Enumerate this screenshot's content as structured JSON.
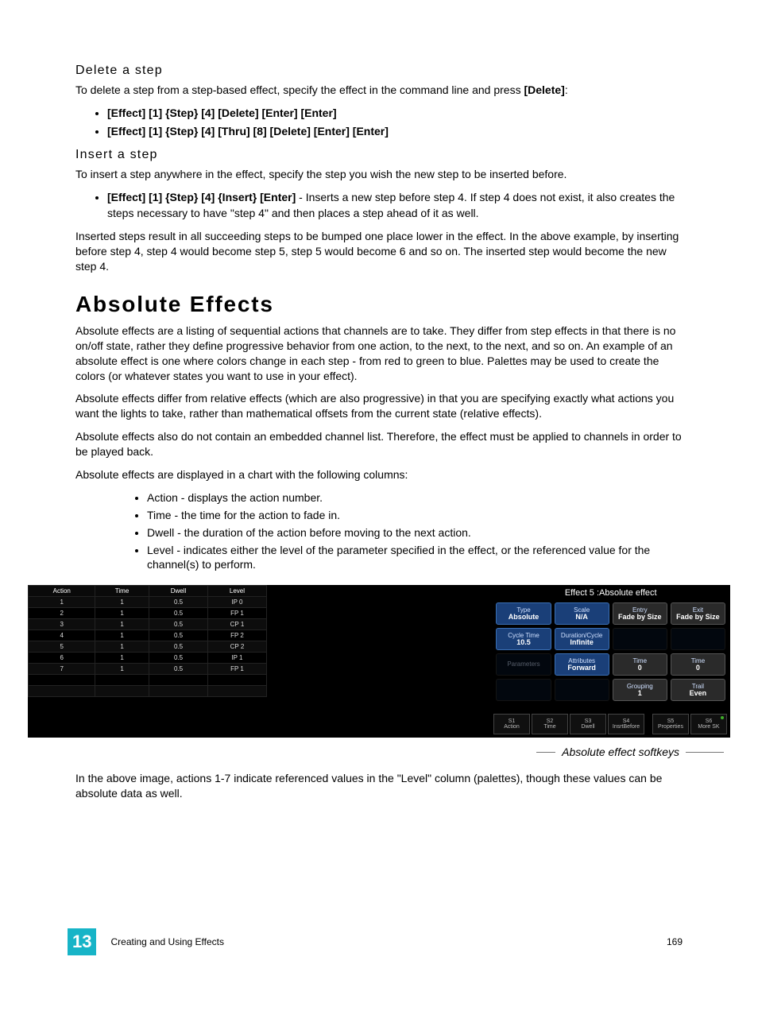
{
  "sections": {
    "delete": {
      "heading": "Delete a step",
      "intro_a": "To delete a step from a step-based effect, specify the effect in the command line and press ",
      "intro_b": "[Delete]",
      "intro_c": ":",
      "bullets": [
        "[Effect] [1] {Step} [4] [Delete] [Enter] [Enter]",
        "[Effect] [1] {Step} [4] [Thru] [8] [Delete] [Enter] [Enter]"
      ]
    },
    "insert": {
      "heading": "Insert a step",
      "intro": "To insert a step anywhere in the effect, specify the step you wish the new step to be inserted before.",
      "bullet_bold": "[Effect] [1] {Step} [4] {Insert} [Enter]",
      "bullet_rest": " - Inserts a new step before step 4. If step 4 does not exist, it also creates the steps necessary to have \"step 4\" and then places a step ahead of it as well.",
      "after": "Inserted steps result in all succeeding steps to be bumped one place lower in the effect. In the above example, by inserting before step 4, step 4 would become step 5, step 5 would become 6 and so on. The inserted step would become the new step 4."
    },
    "absolute": {
      "heading": "Absolute Effects",
      "p1": "Absolute effects are a listing of sequential actions that channels are to take. They differ from step effects in that there is no on/off state, rather they define progressive behavior from one action, to the next, to the next, and so on. An example of an absolute effect is one where colors change in each step - from red to green to blue. Palettes may be used to create the colors (or whatever states you want to use in your effect).",
      "p2": "Absolute effects differ from relative effects (which are also progressive) in that you are specifying exactly what actions you want the lights to take, rather than mathematical offsets from the current state (relative effects).",
      "p3": "Absolute effects also do not contain an embedded channel list. Therefore, the effect must be applied to channels in order to be played back.",
      "p4": "Absolute effects are displayed in a chart with the following columns:",
      "cols": [
        "Action - displays the action number.",
        "Time - the time for the action to fade in.",
        "Dwell - the duration of the action before moving to the next action.",
        "Level - indicates either the level of the parameter specified in the effect, or the referenced value for the channel(s) to perform."
      ],
      "caption": "Absolute effect softkeys",
      "after_img": "In the above image, actions 1-7 indicate referenced values in the \"Level\" column (palettes), though these values can be absolute data as well."
    }
  },
  "ui": {
    "title": "Effect  5 :Absolute effect",
    "table": {
      "headers": [
        "Action",
        "Time",
        "Dwell",
        "Level"
      ],
      "rows": [
        [
          "1",
          "1",
          "0.5",
          "IP 0"
        ],
        [
          "2",
          "1",
          "0.5",
          "FP 1"
        ],
        [
          "3",
          "1",
          "0.5",
          "CP 1"
        ],
        [
          "4",
          "1",
          "0.5",
          "FP 2"
        ],
        [
          "5",
          "1",
          "0.5",
          "CP 2"
        ],
        [
          "6",
          "1",
          "0.5",
          "IP 1"
        ],
        [
          "7",
          "1",
          "0.5",
          "FP 1"
        ]
      ]
    },
    "tiles": [
      {
        "label": "Type",
        "value": "Absolute",
        "cls": "blue"
      },
      {
        "label": "Scale",
        "value": "N/A",
        "cls": "blue"
      },
      {
        "label": "Entry",
        "value": "Fade by Size",
        "cls": "grey"
      },
      {
        "label": "Exit",
        "value": "Fade by Size",
        "cls": "grey"
      },
      {
        "label": "Cycle Time",
        "value": "10.5",
        "cls": "blue"
      },
      {
        "label": "Duration/Cycle",
        "value": "Infinite",
        "cls": "blue"
      },
      {
        "label": "",
        "value": "",
        "cls": "dim"
      },
      {
        "label": "",
        "value": "",
        "cls": "dim"
      },
      {
        "label": "Parameters",
        "value": "",
        "cls": "dim"
      },
      {
        "label": "Attributes",
        "value": "Forward",
        "cls": "blue"
      },
      {
        "label": "Time",
        "value": "0",
        "cls": "grey"
      },
      {
        "label": "Time",
        "value": "0",
        "cls": "grey"
      },
      {
        "label": "",
        "value": "",
        "cls": "dim"
      },
      {
        "label": "",
        "value": "",
        "cls": "dim"
      },
      {
        "label": "Grouping",
        "value": "1",
        "cls": "grey"
      },
      {
        "label": "Trail",
        "value": "Even",
        "cls": "grey"
      }
    ],
    "softkeys": [
      {
        "n": "S1",
        "l": "Action"
      },
      {
        "n": "S2",
        "l": "Time"
      },
      {
        "n": "S3",
        "l": "Dwell"
      },
      {
        "n": "S4",
        "l": "InsrtBefore"
      },
      {
        "n": "S5",
        "l": "Properties"
      },
      {
        "n": "S6",
        "l": "More SK",
        "dot": true
      }
    ]
  },
  "footer": {
    "chapter": "13",
    "left": "Creating and Using Effects",
    "right": "169"
  }
}
